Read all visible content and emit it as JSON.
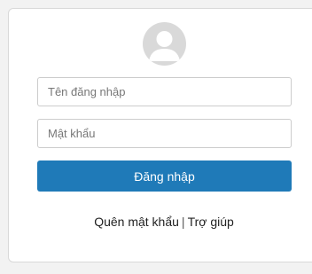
{
  "avatar": {
    "icon": "user-avatar-icon"
  },
  "form": {
    "username_placeholder": "Tên đăng nhập",
    "password_placeholder": "Mật khẩu",
    "login_label": "Đăng nhập"
  },
  "links": {
    "forgot_password": "Quên mật khẩu",
    "separator": "|",
    "help": "Trợ giúp"
  },
  "colors": {
    "accent": "#1f7ab8",
    "avatar_bg": "#d9d9d9",
    "background": "#f2f2f2"
  }
}
